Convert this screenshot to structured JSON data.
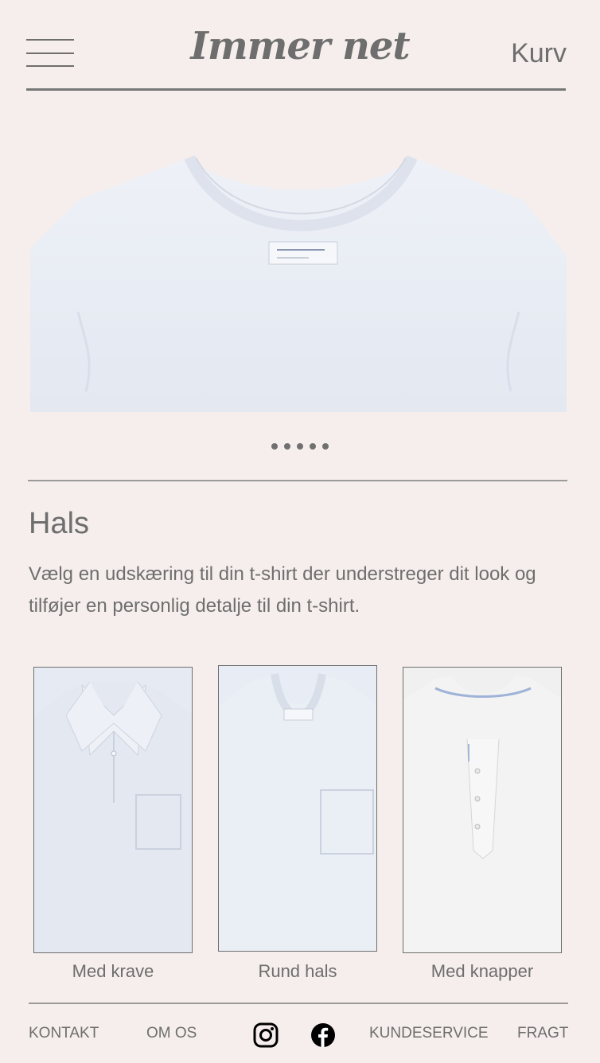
{
  "header": {
    "brand": "Immer net",
    "cart_label": "Kurv"
  },
  "hero": {
    "image_desc": "white-tshirt-front",
    "slides": 5
  },
  "section": {
    "title": "Hals",
    "description": "Vælg en udskæring til din t-shirt der understreger dit look og tilføjer en personlig detalje til din t-shirt."
  },
  "options": [
    {
      "label": "Med krave",
      "icon": "polo-collar-shirt"
    },
    {
      "label": "Rund hals",
      "icon": "crew-neck-shirt"
    },
    {
      "label": "Med knapper",
      "icon": "henley-shirt"
    }
  ],
  "footer": {
    "links": [
      "KONTAKT",
      "OM OS",
      "KUNDESERVICE",
      "FRAGT"
    ],
    "social": [
      "instagram-icon",
      "facebook-icon"
    ]
  },
  "colors": {
    "background": "#f5eeec",
    "text": "#6e6e6e",
    "shirt": "#e9edf3"
  }
}
